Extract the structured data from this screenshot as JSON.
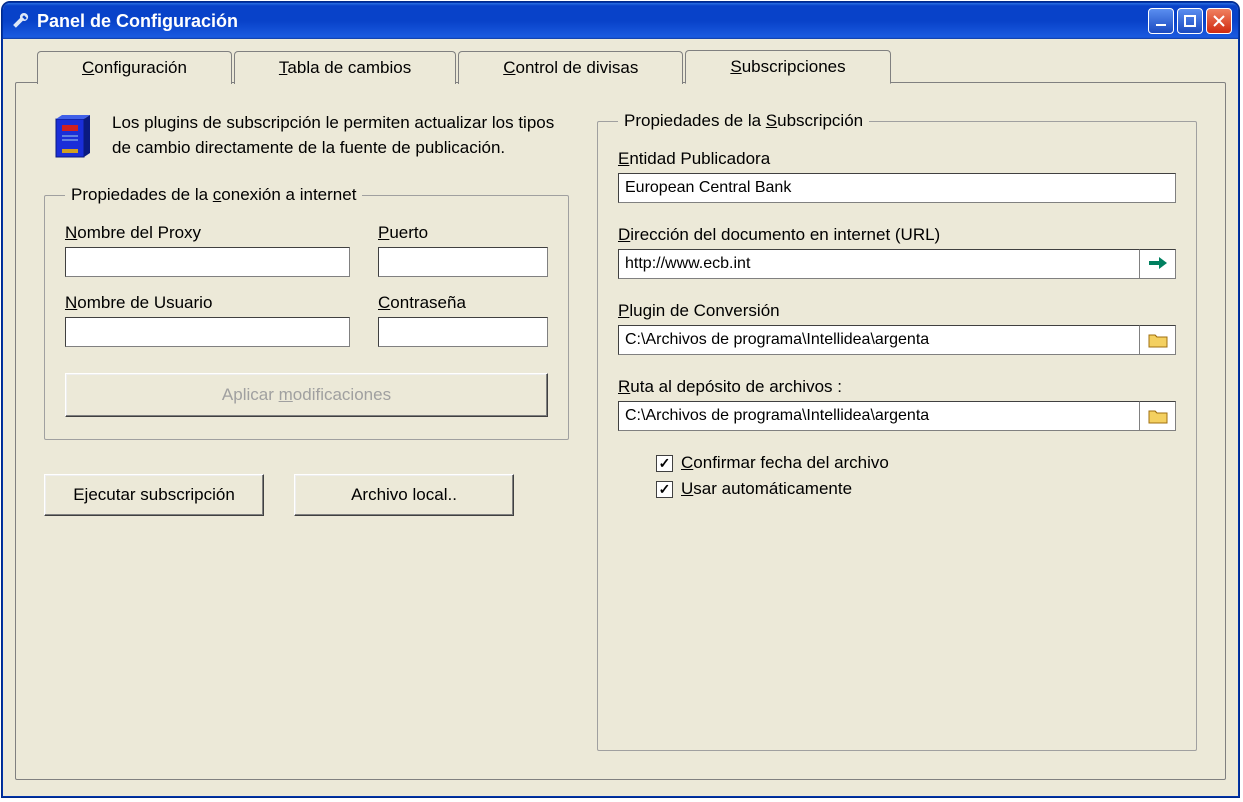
{
  "window": {
    "title": "Panel de Configuración"
  },
  "tabs": {
    "config": "Configuración",
    "tabla": "Tabla de cambios",
    "control": "Control de divisas",
    "subs": "Subscripciones"
  },
  "intro": "Los plugins de subscripción le permiten actualizar  los tipos de cambio  directamente de la fuente de publicación.",
  "conn_group": {
    "legend": "Propiedades de la conexión a internet",
    "proxy_label": "Nombre del Proxy",
    "proxy_value": "",
    "port_label": "Puerto",
    "port_value": "",
    "user_label": "Nombre de Usuario",
    "user_value": "",
    "pass_label": "Contraseña",
    "pass_value": "",
    "apply_label": "Aplicar modificaciones"
  },
  "buttons": {
    "run": "Ejecutar subscripción",
    "local": "Archivo local.."
  },
  "sub_group": {
    "legend": "Propiedades de la Subscripción",
    "entity_label": "Entidad Publicadora",
    "entity_value": "European Central Bank",
    "url_label": "Dirección del documento en internet (URL)",
    "url_value": "http://www.ecb.int",
    "plugin_label": "Plugin de Conversión",
    "plugin_value": "C:\\Archivos de programa\\Intellidea\\argenta",
    "path_label": "Ruta al depósito de archivos :",
    "path_value": "C:\\Archivos de programa\\Intellidea\\argenta",
    "chk_confirm": "Confirmar fecha del archivo",
    "chk_auto": "Usar automáticamente"
  }
}
